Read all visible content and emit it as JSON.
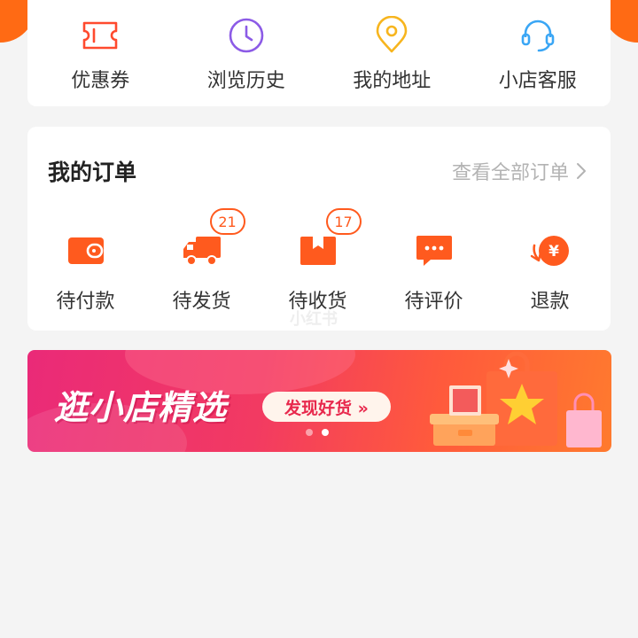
{
  "quick_menu": {
    "items": [
      {
        "label": "优惠券",
        "icon": "coupon-icon"
      },
      {
        "label": "浏览历史",
        "icon": "clock-icon"
      },
      {
        "label": "我的地址",
        "icon": "location-pin-icon"
      },
      {
        "label": "小店客服",
        "icon": "headset-icon"
      }
    ]
  },
  "orders": {
    "title": "我的订单",
    "view_all": "查看全部订单",
    "items": [
      {
        "label": "待付款",
        "icon": "wallet-icon",
        "badge": ""
      },
      {
        "label": "待发货",
        "icon": "truck-icon",
        "badge": "21"
      },
      {
        "label": "待收货",
        "icon": "package-icon",
        "badge": "17"
      },
      {
        "label": "待评价",
        "icon": "comment-icon",
        "badge": ""
      },
      {
        "label": "退款",
        "icon": "refund-icon",
        "badge": ""
      }
    ],
    "watermark": "小红书"
  },
  "banner": {
    "title": "逛小店精选",
    "button": "发现好货 »",
    "slide_count": 2,
    "active_slide": 2
  },
  "colors": {
    "accent": "#ff5a1e",
    "background": "#f4f4f4"
  }
}
